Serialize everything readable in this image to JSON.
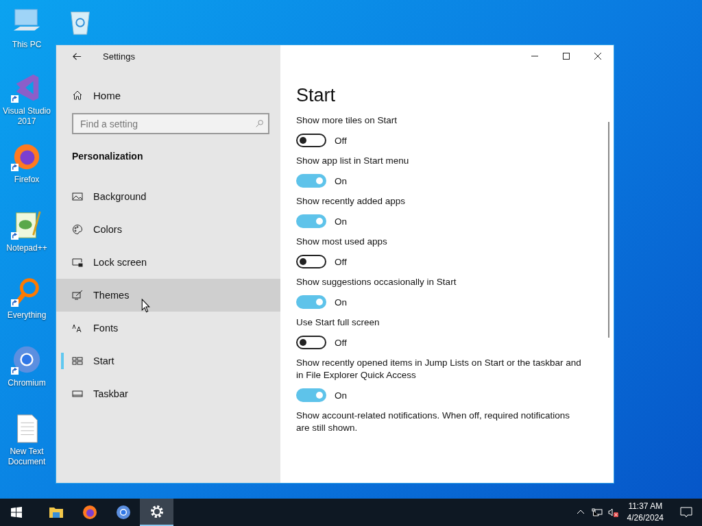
{
  "desktop_icons": [
    {
      "kind": "pc",
      "label": "This PC",
      "shortcut": false
    },
    {
      "kind": "bin",
      "shortcut": false
    },
    {
      "kind": "vs",
      "label": "Visual Studio 2017",
      "shortcut": true
    },
    {
      "kind": "firefox",
      "label": "Firefox",
      "shortcut": true
    },
    {
      "kind": "notepad",
      "label": "Notepad++",
      "shortcut": true
    },
    {
      "kind": "everything",
      "label": "Everything",
      "shortcut": true
    },
    {
      "kind": "chromium",
      "label": "Chromium",
      "shortcut": true
    },
    {
      "kind": "text",
      "label": "New Text Document",
      "shortcut": false
    }
  ],
  "window": {
    "title": "Settings"
  },
  "sidebar": {
    "home": "Home",
    "search": {
      "placeholder": "Find a setting"
    },
    "section": "Personalization",
    "items": [
      {
        "kind": "background",
        "label": "Background",
        "selected": false,
        "hovered": false
      },
      {
        "kind": "colors",
        "label": "Colors",
        "selected": false,
        "hovered": false
      },
      {
        "kind": "lock",
        "label": "Lock screen",
        "selected": false,
        "hovered": false
      },
      {
        "kind": "themes",
        "label": "Themes",
        "selected": false,
        "hovered": true
      },
      {
        "kind": "fonts",
        "label": "Fonts",
        "selected": false,
        "hovered": false
      },
      {
        "kind": "start",
        "label": "Start",
        "selected": true,
        "hovered": false
      },
      {
        "kind": "taskbar",
        "label": "Taskbar",
        "selected": false,
        "hovered": false
      }
    ]
  },
  "content": {
    "title": "Start",
    "settings": [
      {
        "label": "Show more tiles on Start",
        "on": false,
        "state": "Off"
      },
      {
        "label": "Show app list in Start menu",
        "on": true,
        "state": "On"
      },
      {
        "label": "Show recently added apps",
        "on": true,
        "state": "On"
      },
      {
        "label": "Show most used apps",
        "on": false,
        "state": "Off"
      },
      {
        "label": "Show suggestions occasionally in Start",
        "on": true,
        "state": "On"
      },
      {
        "label": "Use Start full screen",
        "on": false,
        "state": "Off"
      },
      {
        "label": "Show recently opened items in Jump Lists on Start or the taskbar and in File Explorer Quick Access",
        "on": true,
        "state": "On"
      },
      {
        "label": "Show account-related notifications. When off, required notifications are still shown."
      }
    ]
  },
  "taskbar": {
    "apps": [
      {
        "kind": "explorer",
        "selected": false
      },
      {
        "kind": "firefox",
        "selected": false
      },
      {
        "kind": "chromium",
        "selected": false
      },
      {
        "kind": "settings",
        "selected": true
      }
    ],
    "time": "11:37 AM",
    "date": "4/26/2024"
  }
}
